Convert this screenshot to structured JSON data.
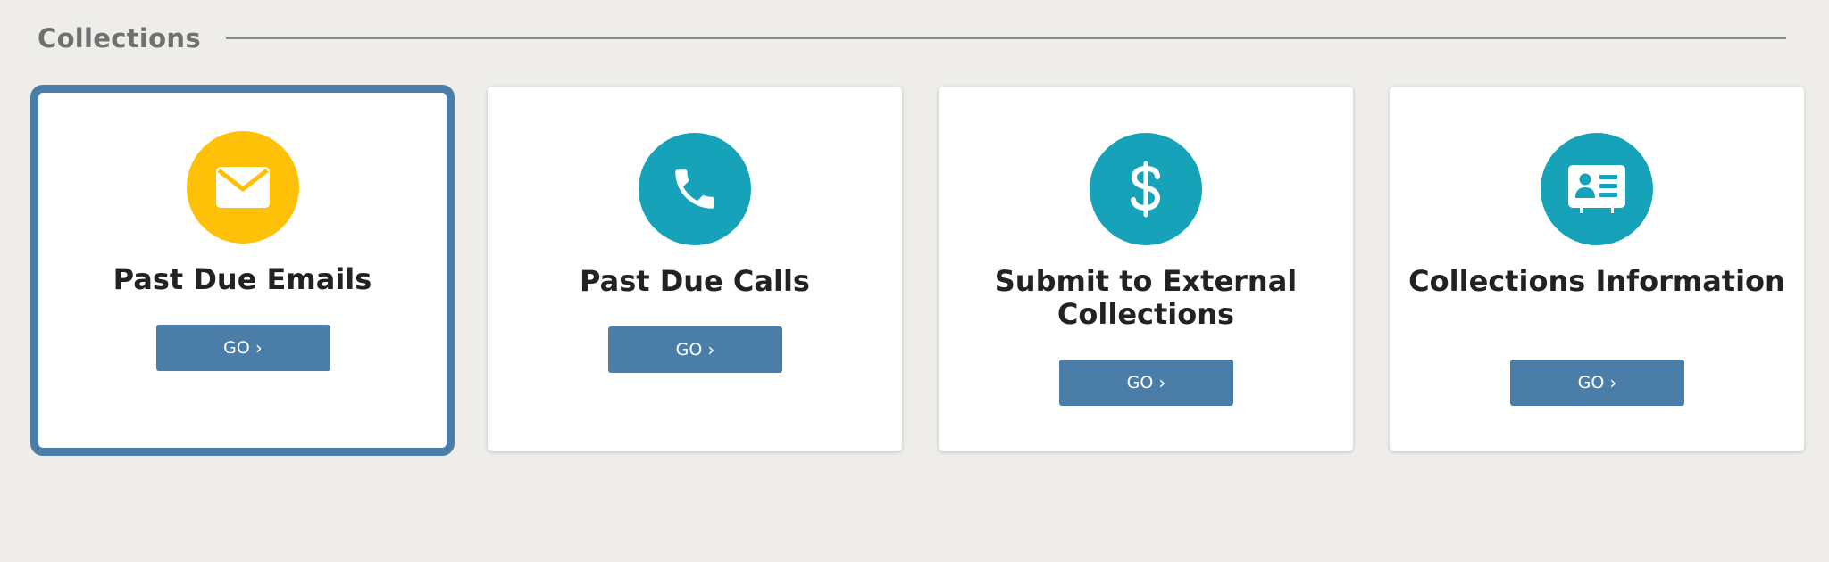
{
  "section": {
    "title": "Collections"
  },
  "cards": [
    {
      "title": "Past Due Emails",
      "button_label": "GO",
      "button_chevron": "›",
      "icon": "envelope-icon",
      "icon_color": "#ffc107",
      "selected": true
    },
    {
      "title": "Past Due Calls",
      "button_label": "GO",
      "button_chevron": "›",
      "icon": "phone-icon",
      "icon_color": "#16a2b8",
      "selected": false
    },
    {
      "title": "Submit to External Collections",
      "button_label": "GO",
      "button_chevron": "›",
      "icon": "dollar-icon",
      "icon_color": "#16a2b8",
      "selected": false
    },
    {
      "title": "Collections Information",
      "button_label": "GO",
      "button_chevron": "›",
      "icon": "id-card-icon",
      "icon_color": "#16a2b8",
      "selected": false
    }
  ],
  "colors": {
    "page_background": "#eeedea",
    "selected_border": "#4a7ea8",
    "button_background": "#4a7ea8",
    "accent_teal": "#16a2b8",
    "accent_yellow": "#ffc107"
  }
}
